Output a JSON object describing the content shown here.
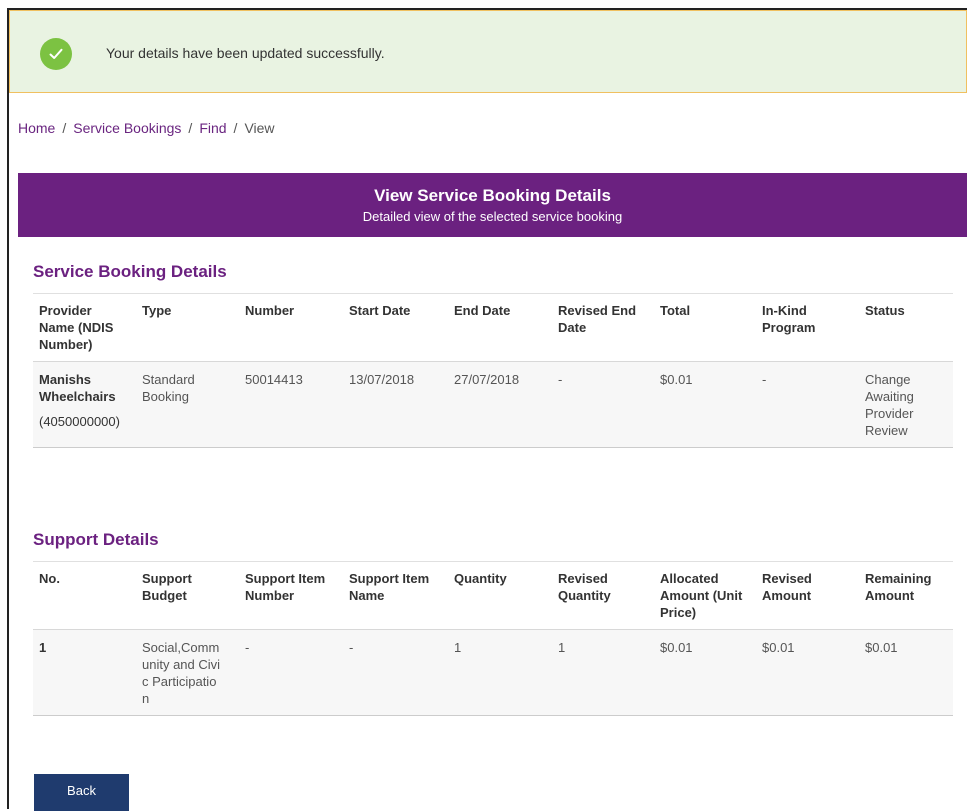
{
  "alert": {
    "message": "Your details have been updated successfully.",
    "icon": "check-icon",
    "color": "#7cc242"
  },
  "breadcrumb": [
    "Home",
    "Service Bookings",
    "Find",
    "View"
  ],
  "banner": {
    "title": "View Service Booking Details",
    "subtitle": "Detailed view of the selected service booking",
    "color": "#6b2180"
  },
  "service_booking": {
    "heading": "Service Booking Details",
    "columns": [
      "Provider Name (NDIS Number)",
      "Type",
      "Number",
      "Start Date",
      "End Date",
      "Revised End Date",
      "Total",
      "In-Kind Program",
      "Status"
    ],
    "row": {
      "provider_name": "Manishs Wheelchairs",
      "provider_number": "(4050000000)",
      "type": "Standard Booking",
      "number": "50014413",
      "start_date": "13/07/2018",
      "end_date": "27/07/2018",
      "revised_end_date": "-",
      "total": "$0.01",
      "in_kind": "-",
      "status": "Change Awaiting Provider Review"
    }
  },
  "support_details": {
    "heading": "Support Details",
    "columns": [
      "No.",
      "Support Budget",
      "Support Item Number",
      "Support Item Name",
      "Quantity",
      "Revised Quantity",
      "Allocated Amount (Unit Price)",
      "Revised Amount",
      "Remaining Amount"
    ],
    "rows": [
      [
        "1",
        "Social,Community and Civic Participation",
        "-",
        "-",
        "1",
        "1",
        "$0.01",
        "$0.01",
        "$0.01"
      ]
    ]
  },
  "back_label": "Back"
}
